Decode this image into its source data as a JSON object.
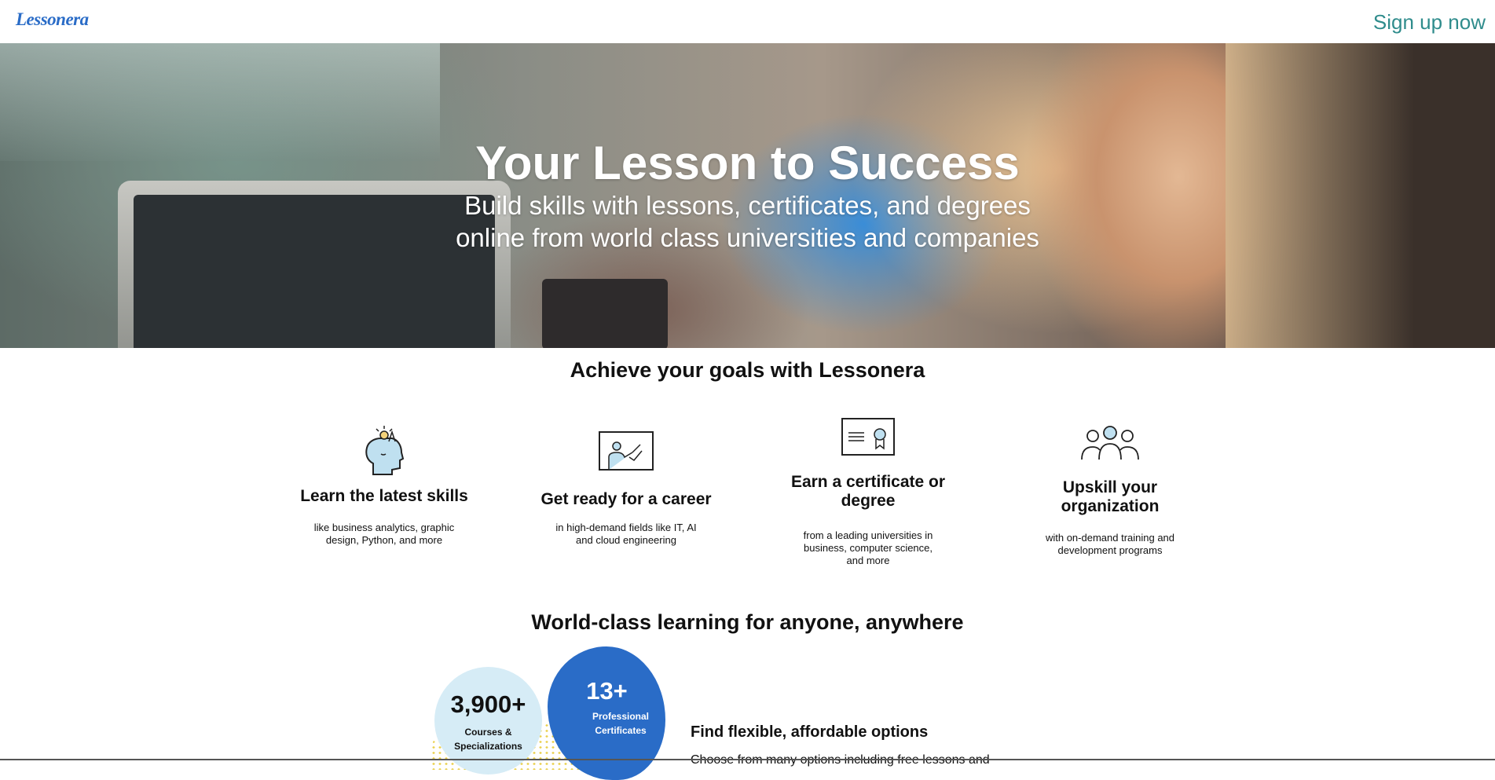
{
  "header": {
    "logo": "Lessonera",
    "signup_label": "Sign up now"
  },
  "hero": {
    "title": "Your Lesson to Success",
    "subtitle_line1": "Build skills with lessons, certificates, and degrees",
    "subtitle_line2": "online from world class universities and companies"
  },
  "goals": {
    "heading": "Achieve your goals with Lessonera",
    "features": [
      {
        "icon": "head-lightbulb-icon",
        "title": "Learn the latest skills",
        "text": "like business analytics, graphic design, Python, and more"
      },
      {
        "icon": "presentation-board-icon",
        "title": "Get ready for a career",
        "text": "in high-demand fields like IT, AI and cloud engineering"
      },
      {
        "icon": "certificate-icon",
        "title": "Earn a certificate or degree",
        "text": "from a leading universities in business, computer science, and more"
      },
      {
        "icon": "people-group-icon",
        "title": "Upskill your organization",
        "text": "with on-demand training and development programs"
      }
    ]
  },
  "world": {
    "heading": "World-class learning for anyone, anywhere",
    "stat1_value": "3,900+",
    "stat1_label": "Courses & Specializations",
    "stat2_value": "13+",
    "stat2_label": "Professional Certificates",
    "options_title": "Find flexible, affordable options",
    "options_text": "Choose from many options including free lessons and"
  },
  "colors": {
    "brand_blue": "#2a6cc7",
    "signup_teal": "#2f8c8c",
    "light_blue": "#d6ecf6"
  }
}
